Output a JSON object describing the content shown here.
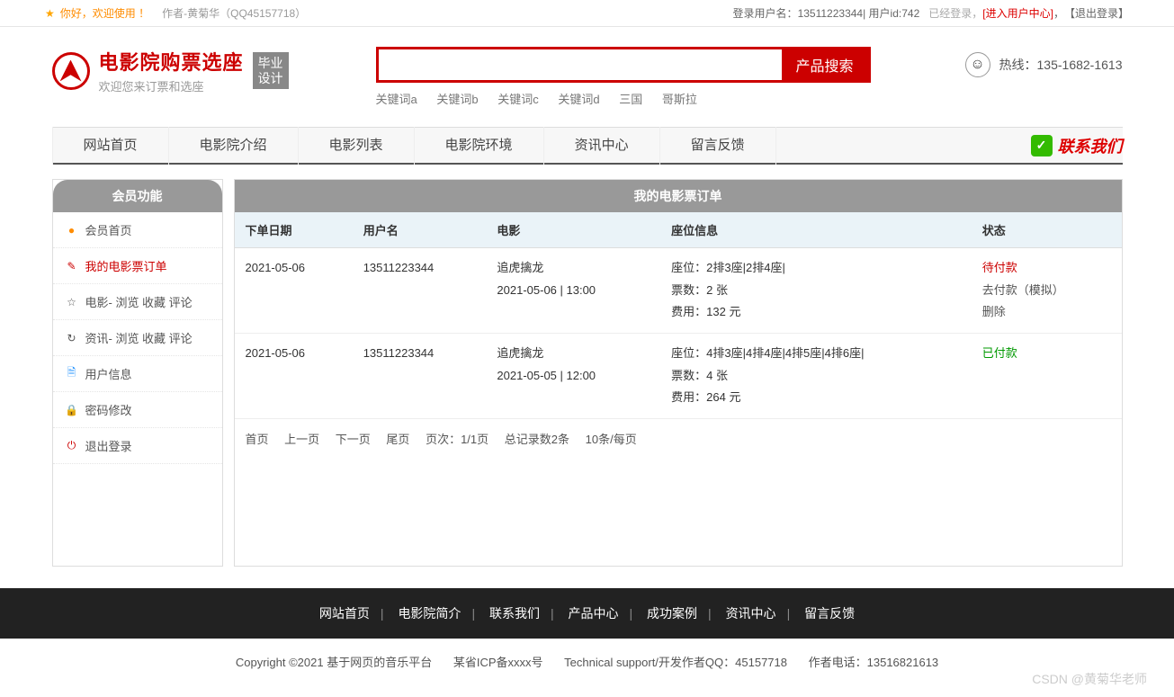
{
  "topbar": {
    "welcome": "你好，欢迎使用 ！",
    "author": "作者-黄菊华（QQ45157718）",
    "login_user_label": "登录用户名：",
    "login_user": "13511223344",
    "user_id_label": " | 用户id: ",
    "user_id": "742",
    "logged_in": "已经登录，",
    "enter_center": "[进入用户中心]",
    "comma": "，  ",
    "logout": "【退出登录】"
  },
  "logo": {
    "title": "电影院购票选座",
    "subtitle": "欢迎您来订票和选座",
    "badge_l1": "毕业",
    "badge_l2": "设计"
  },
  "search": {
    "button": "产品搜索",
    "keywords": [
      "关键词a",
      "关键词b",
      "关键词c",
      "关键词d",
      "三国",
      "哥斯拉"
    ]
  },
  "hotline": {
    "label": "热线：",
    "number": "135-1682-1613"
  },
  "nav": {
    "items": [
      "网站首页",
      "电影院介绍",
      "电影列表",
      "电影院环境",
      "资讯中心",
      "留言反馈"
    ],
    "contact": "联系我们"
  },
  "sidebar": {
    "header": "会员功能",
    "items": [
      {
        "label": "会员首页"
      },
      {
        "label": "我的电影票订单"
      },
      {
        "label": "电影- 浏览  收藏  评论"
      },
      {
        "label": "资讯- 浏览  收藏  评论"
      },
      {
        "label": "用户信息"
      },
      {
        "label": "密码修改"
      },
      {
        "label": "退出登录"
      }
    ]
  },
  "content": {
    "header": "我的电影票订单",
    "columns": [
      "下单日期",
      "用户名",
      "电影",
      "座位信息",
      "状态"
    ],
    "rows": [
      {
        "date": "2021-05-06",
        "user": "13511223344",
        "movie_l1": "追虎擒龙",
        "movie_l2": "2021-05-06 | 13:00",
        "seat_l1": "座位：2排3座|2排4座|",
        "seat_l2": "票数：2 张",
        "seat_l3": "费用：132 元",
        "status": "待付款",
        "status_class": "status-pending",
        "action1": "去付款（模拟）",
        "action2": "删除"
      },
      {
        "date": "2021-05-06",
        "user": "13511223344",
        "movie_l1": "追虎擒龙",
        "movie_l2": "2021-05-05 | 12:00",
        "seat_l1": "座位：4排3座|4排4座|4排5座|4排6座|",
        "seat_l2": "票数：4 张",
        "seat_l3": "费用：264 元",
        "status": "已付款",
        "status_class": "status-paid",
        "action1": "",
        "action2": ""
      }
    ],
    "pagination": {
      "first": "首页",
      "prev": "上一页",
      "next": "下一页",
      "last": "尾页",
      "pageinfo": "页次：1/1页",
      "total": "总记录数2条",
      "perpage": "10条/每页"
    }
  },
  "footer": {
    "nav": [
      "网站首页",
      "电影院简介",
      "联系我们",
      "产品中心",
      "成功案例",
      "资讯中心",
      "留言反馈"
    ],
    "copy_1": "Copyright ©2021 基于网页的音乐平台",
    "copy_2": "某省ICP备xxxx号",
    "copy_3": "Technical support/开发作者QQ：45157718",
    "copy_4": "作者电话：13516821613",
    "watermark": "CSDN @黄菊华老师"
  }
}
